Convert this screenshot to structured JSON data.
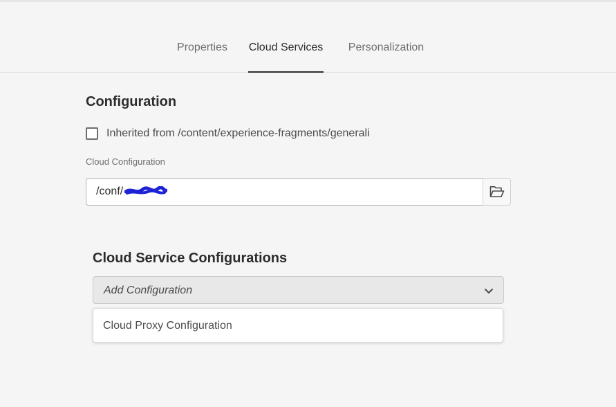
{
  "tabs": [
    {
      "label": "Properties",
      "active": false
    },
    {
      "label": "Cloud Services",
      "active": true
    },
    {
      "label": "Personalization",
      "active": false
    }
  ],
  "configuration": {
    "title": "Configuration",
    "inherit_checkbox": {
      "label": "Inherited from /content/experience-fragments/generali",
      "checked": false
    },
    "field_label": "Cloud Configuration",
    "path_value": "/conf/",
    "redaction_color": "#1f23d6",
    "browse_icon": "folder-icon"
  },
  "cloud_service_configurations": {
    "title": "Cloud Service Configurations",
    "select_placeholder": "Add Configuration",
    "select_icon": "chevron-down-icon",
    "options": [
      "Cloud Proxy Configuration"
    ]
  }
}
